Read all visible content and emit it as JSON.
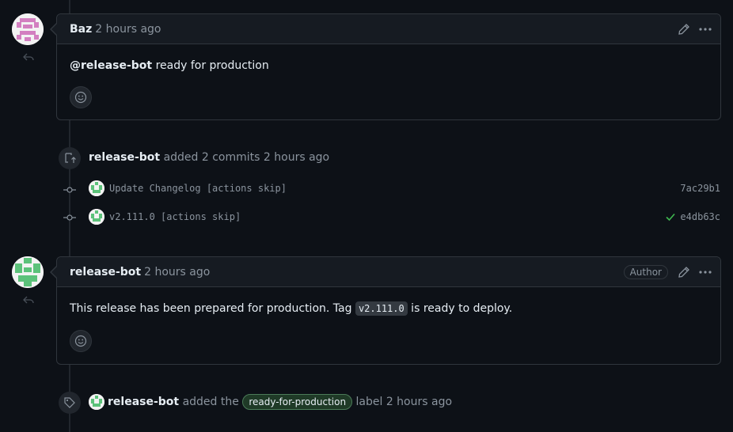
{
  "comment1": {
    "author": "Baz",
    "time": "2 hours ago",
    "mention": "@release-bot",
    "text": " ready for production"
  },
  "commits_event": {
    "actor": "release-bot",
    "text": "added 2 commits 2 hours ago",
    "commits": [
      {
        "message": "Update Changelog [actions skip]",
        "sha": "7ac29b1",
        "status": ""
      },
      {
        "message": "v2.111.0 [actions skip]",
        "sha": "e4db63c",
        "status": "success"
      }
    ]
  },
  "comment2": {
    "author": "release-bot",
    "time": "2 hours ago",
    "badge": "Author",
    "text_before": "This release has been prepared for production. Tag ",
    "code": "v2.111.0",
    "text_after": " is ready to deploy."
  },
  "label_event": {
    "actor": "release-bot",
    "text_before": "added the",
    "label": "ready-for-production",
    "text_after": "label 2 hours ago"
  },
  "colors": {
    "background": "#0d1117",
    "header": "#161b22",
    "border": "#30363d",
    "success": "#3fb950",
    "label_bg": "#1f3a27"
  }
}
